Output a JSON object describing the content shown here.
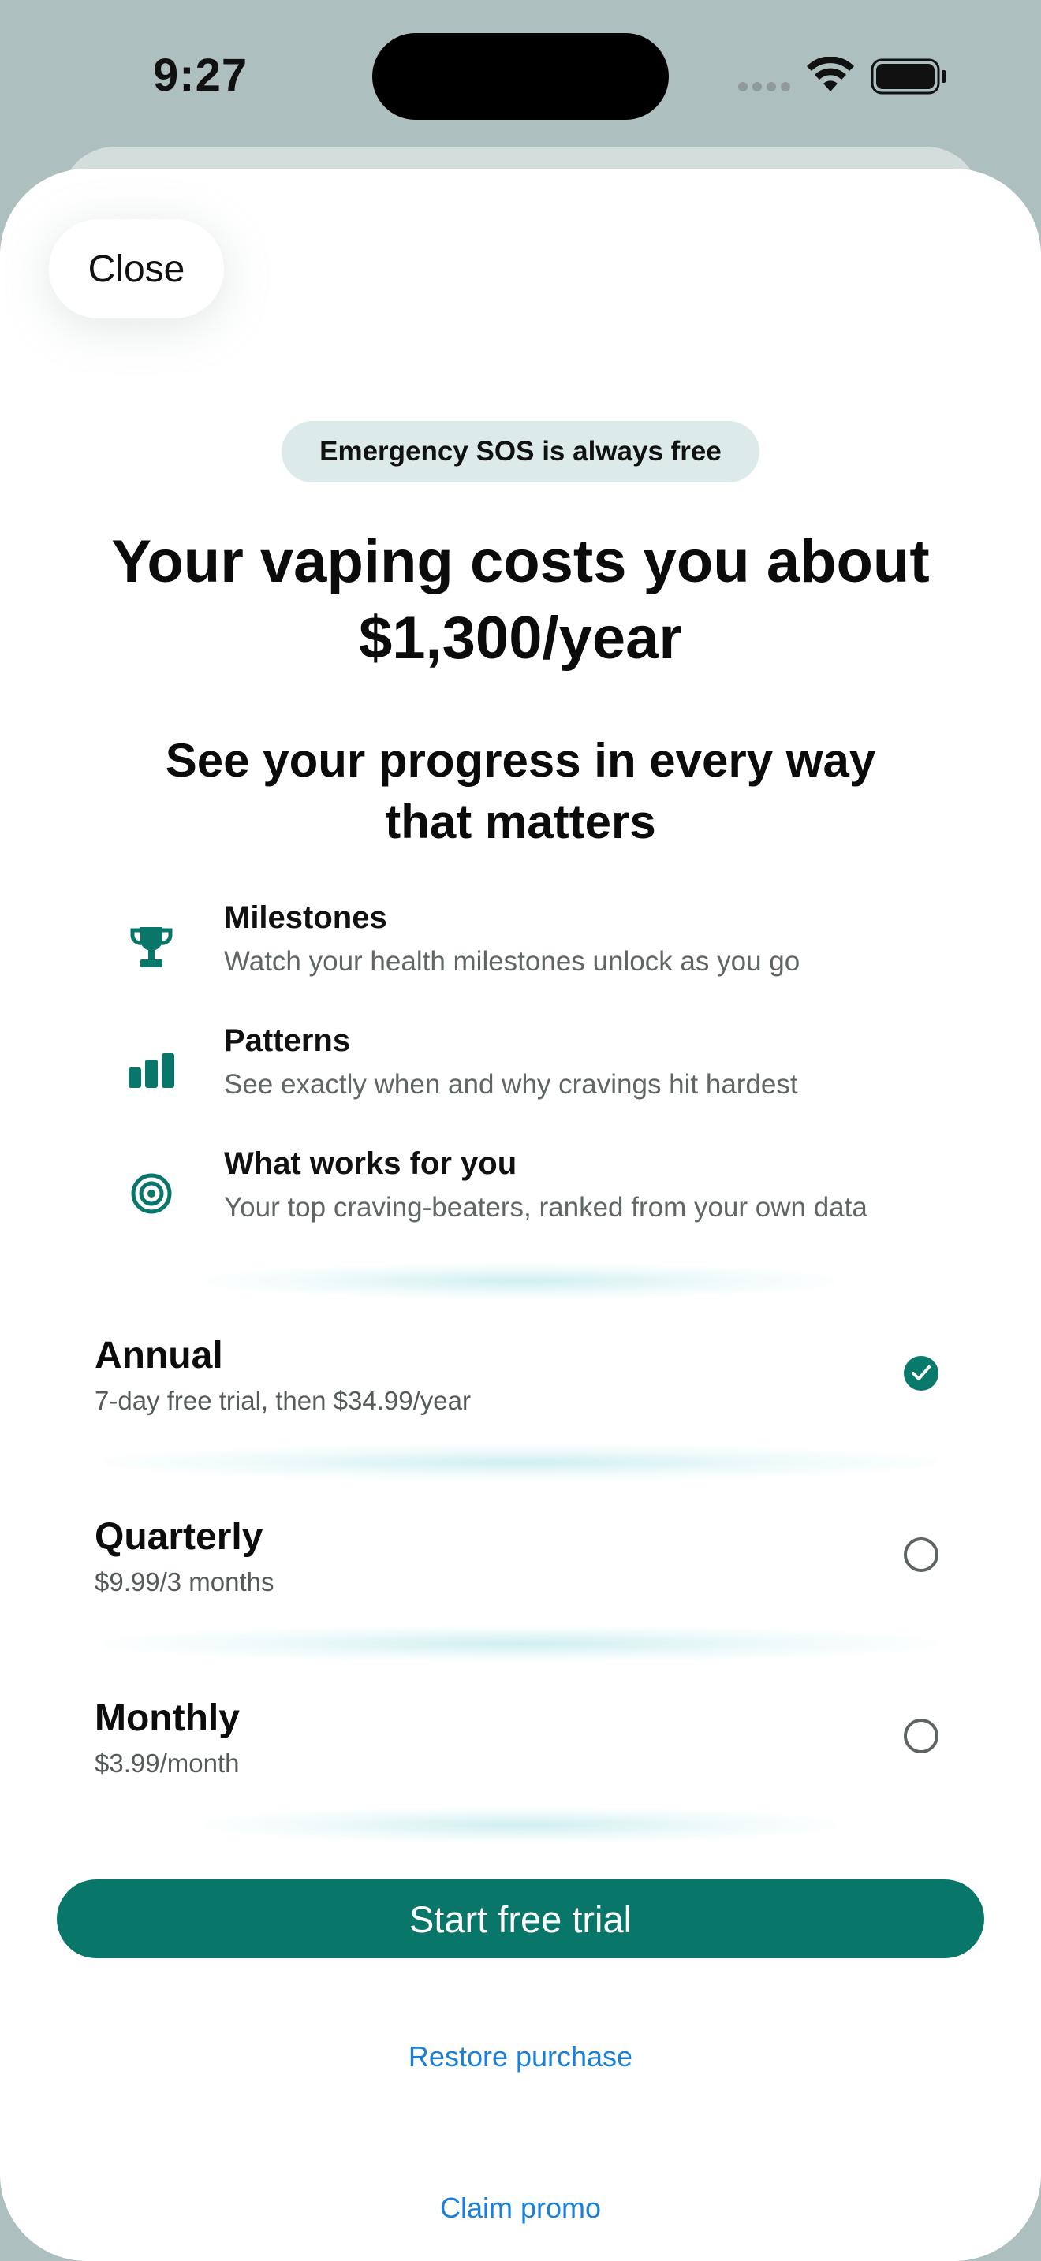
{
  "status_bar": {
    "time": "9:27"
  },
  "sheet": {
    "close_label": "Close",
    "badge": "Emergency SOS is always free",
    "headline_line1": "Your vaping costs you about",
    "headline_line2": "$1,300/year",
    "subheadline_line1": "See your progress in every way",
    "subheadline_line2": "that matters",
    "features": [
      {
        "icon": "trophy-icon",
        "title": "Milestones",
        "description": "Watch your health milestones unlock as you go"
      },
      {
        "icon": "bar-chart-icon",
        "title": "Patterns",
        "description": "See exactly when and why cravings hit hardest"
      },
      {
        "icon": "target-icon",
        "title": "What works for you",
        "description": "Your top craving-beaters, ranked from your own data"
      }
    ],
    "plans": [
      {
        "name": "Annual",
        "price": "7-day free trial, then $34.99/year",
        "selected": true
      },
      {
        "name": "Quarterly",
        "price": "$9.99/3 months",
        "selected": false
      },
      {
        "name": "Monthly",
        "price": "$3.99/month",
        "selected": false
      }
    ],
    "cta_label": "Start free trial",
    "restore_label": "Restore purchase",
    "promo_label": "Claim promo"
  },
  "colors": {
    "accent": "#08776a",
    "link": "#1a7fd6",
    "backdrop": "#adbfbe",
    "badge_bg": "#dcebea"
  }
}
